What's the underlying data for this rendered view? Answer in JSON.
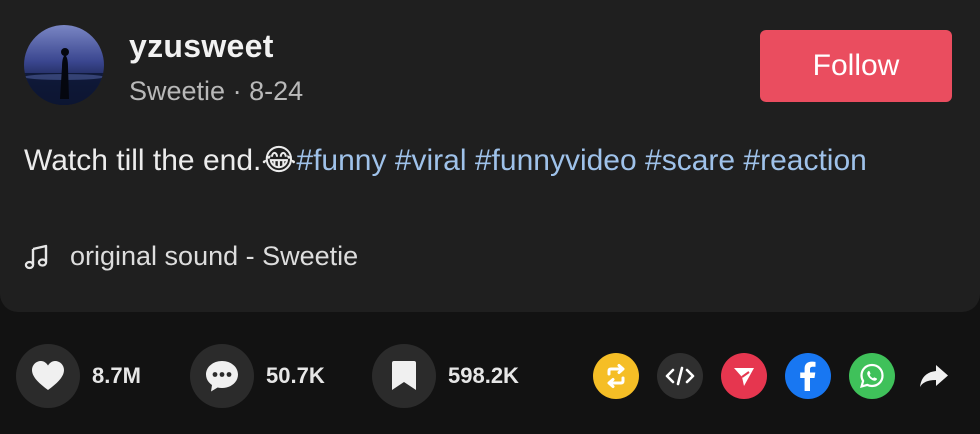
{
  "author": {
    "username": "yzusweet",
    "display_name": "Sweetie",
    "separator": " · ",
    "date": "8-24",
    "follow_label": "Follow"
  },
  "caption": {
    "text": "Watch till the end.",
    "emoji": "😂",
    "hashtags": [
      "#funny",
      "#viral",
      "#funnyvideo",
      "#scare",
      "#reaction"
    ]
  },
  "sound": {
    "label": "original sound - Sweetie"
  },
  "stats": {
    "likes": "8.7M",
    "comments": "50.7K",
    "saves": "598.2K"
  },
  "share_icons": [
    "repost-icon",
    "embed-icon",
    "send-icon",
    "facebook-icon",
    "whatsapp-icon",
    "share-arrow-icon"
  ],
  "colors": {
    "follow": "#ea4d5f",
    "hashtag": "#9fc2ea",
    "repost": "#f5be26",
    "embed": "#2f2f2f",
    "send": "#e6364f",
    "facebook": "#1877f2",
    "whatsapp": "#3fc15a"
  }
}
